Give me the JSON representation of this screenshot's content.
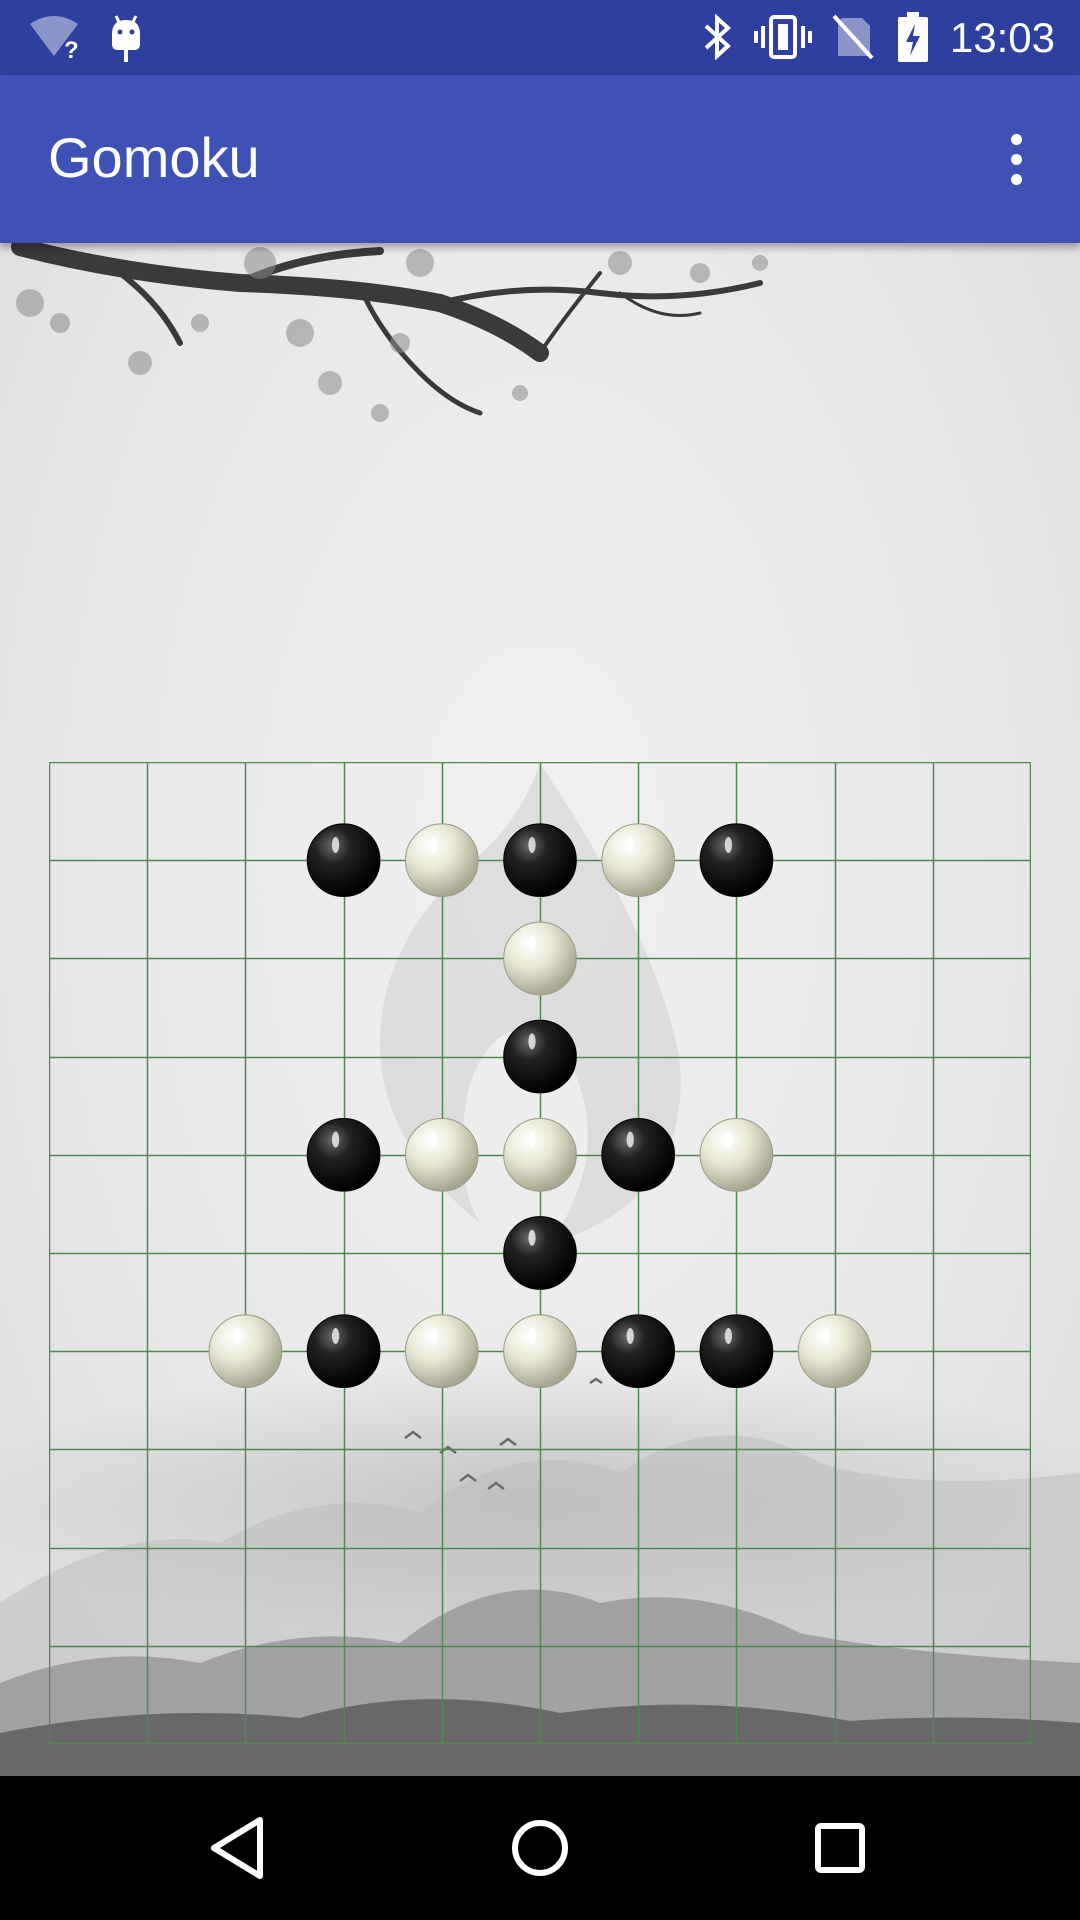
{
  "status_bar": {
    "time": "13:03",
    "icons": [
      "wifi-unknown-icon",
      "android-debug-icon",
      "bluetooth-icon",
      "vibrate-icon",
      "no-sim-icon",
      "battery-charging-icon"
    ]
  },
  "app_bar": {
    "title": "Gomoku",
    "menu_icon": "more-vert-icon"
  },
  "board": {
    "size": 10,
    "line_color": "#4e8a4e",
    "stones": [
      {
        "row": 1,
        "col": 3,
        "color": "black"
      },
      {
        "row": 1,
        "col": 4,
        "color": "white"
      },
      {
        "row": 1,
        "col": 5,
        "color": "black"
      },
      {
        "row": 1,
        "col": 6,
        "color": "white"
      },
      {
        "row": 1,
        "col": 7,
        "color": "black"
      },
      {
        "row": 2,
        "col": 5,
        "color": "white"
      },
      {
        "row": 3,
        "col": 5,
        "color": "black"
      },
      {
        "row": 4,
        "col": 3,
        "color": "black"
      },
      {
        "row": 4,
        "col": 4,
        "color": "white"
      },
      {
        "row": 4,
        "col": 5,
        "color": "white"
      },
      {
        "row": 4,
        "col": 6,
        "color": "black"
      },
      {
        "row": 4,
        "col": 7,
        "color": "white"
      },
      {
        "row": 5,
        "col": 5,
        "color": "black"
      },
      {
        "row": 6,
        "col": 2,
        "color": "white"
      },
      {
        "row": 6,
        "col": 3,
        "color": "black"
      },
      {
        "row": 6,
        "col": 4,
        "color": "white"
      },
      {
        "row": 6,
        "col": 5,
        "color": "white"
      },
      {
        "row": 6,
        "col": 6,
        "color": "black"
      },
      {
        "row": 6,
        "col": 7,
        "color": "black"
      },
      {
        "row": 6,
        "col": 8,
        "color": "white"
      }
    ]
  },
  "nav_bar": {
    "icons": [
      "back-icon",
      "home-icon",
      "recents-icon"
    ]
  },
  "colors": {
    "status_bar": "#2f3f9f",
    "app_bar": "#3f51b5",
    "background": "#e8e8e8"
  }
}
